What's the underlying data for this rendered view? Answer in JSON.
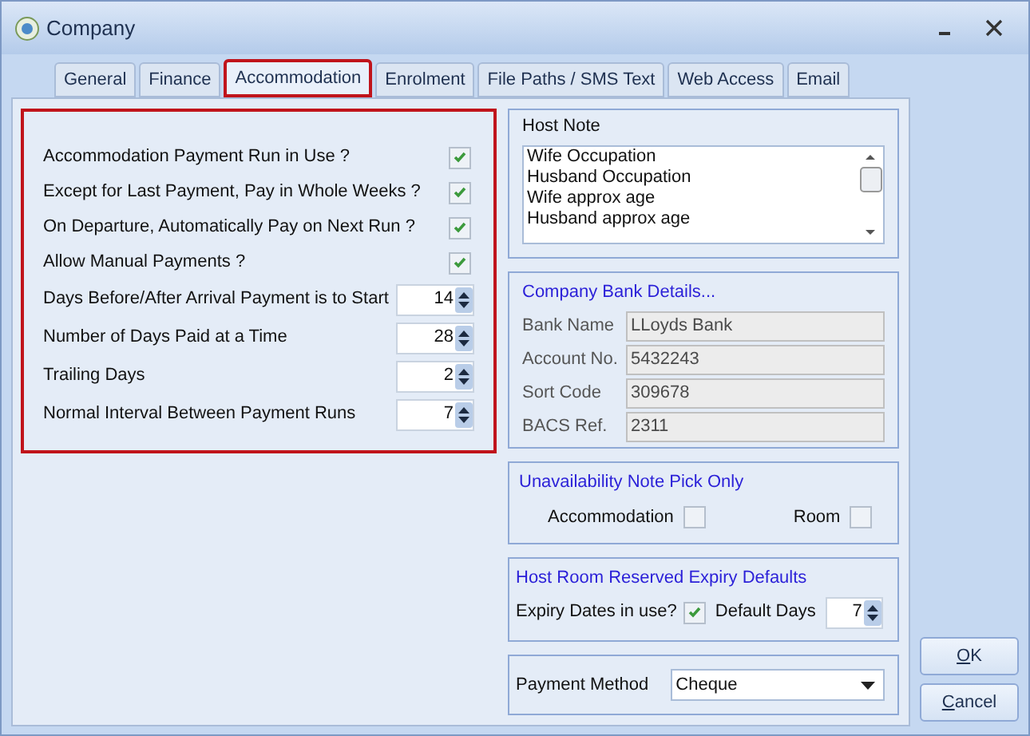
{
  "window": {
    "title": "Company"
  },
  "tabs": [
    {
      "label": "General",
      "selected": false
    },
    {
      "label": "Finance",
      "selected": false
    },
    {
      "label": "Accommodation",
      "selected": true
    },
    {
      "label": "Enrolment",
      "selected": false
    },
    {
      "label": "File Paths / SMS Text",
      "selected": false
    },
    {
      "label": "Web Access",
      "selected": false
    },
    {
      "label": "Email",
      "selected": false
    }
  ],
  "settings": [
    {
      "kind": "checkbox",
      "label": "Accommodation Payment Run in Use ?",
      "checked": true
    },
    {
      "kind": "checkbox",
      "label": "Except for Last Payment, Pay in Whole Weeks ?",
      "checked": true
    },
    {
      "kind": "checkbox",
      "label": "On Departure, Automatically Pay on Next Run ?",
      "checked": true
    },
    {
      "kind": "checkbox",
      "label": "Allow Manual Payments ?",
      "checked": true
    },
    {
      "kind": "spinner",
      "label": "Days Before/After Arrival Payment is to Start",
      "value": "14"
    },
    {
      "kind": "spinner",
      "label": "Number of Days Paid at a Time",
      "value": "28"
    },
    {
      "kind": "spinner",
      "label": "Trailing Days",
      "value": "2"
    },
    {
      "kind": "spinner",
      "label": "Normal Interval Between Payment Runs",
      "value": "7"
    }
  ],
  "host_note": {
    "title": "Host Note",
    "lines": [
      "Wife Occupation",
      "Husband Occupation",
      "Wife approx age",
      "Husband approx age"
    ]
  },
  "bank": {
    "title": "Company Bank Details...",
    "fields": [
      {
        "label": "Bank Name",
        "value": "LLoyds Bank"
      },
      {
        "label": "Account No.",
        "value": "5432243"
      },
      {
        "label": "Sort Code",
        "value": "309678"
      },
      {
        "label": "BACS Ref.",
        "value": "2311"
      }
    ]
  },
  "unavailability": {
    "title": "Unavailability Note Pick Only",
    "options": [
      {
        "label": "Accommodation",
        "checked": false
      },
      {
        "label": "Room",
        "checked": false
      }
    ]
  },
  "expiry": {
    "title": "Host Room Reserved Expiry Defaults",
    "checkbox": {
      "label": "Expiry Dates in use?",
      "checked": true
    },
    "days": {
      "label": "Default Days",
      "value": "7"
    }
  },
  "payment_method": {
    "label": "Payment Method",
    "value": "Cheque"
  },
  "buttons": [
    "OK",
    "Cancel"
  ]
}
